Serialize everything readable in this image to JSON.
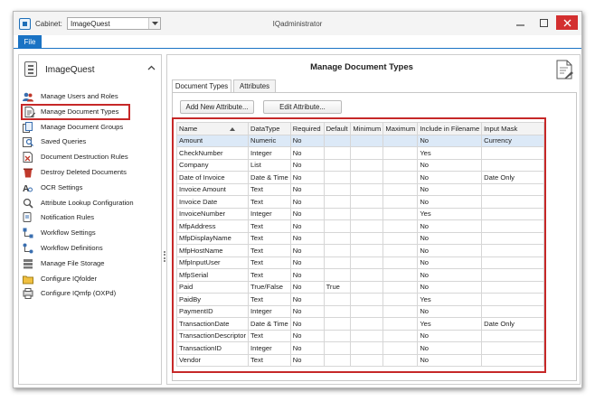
{
  "window": {
    "title": "IQadministrator",
    "cabinet_label": "Cabinet:",
    "cabinet_value": "ImageQuest"
  },
  "ribbon": {
    "file_tab": "File"
  },
  "sidebar": {
    "header": "ImageQuest",
    "items": [
      {
        "label": "Manage Users and Roles",
        "icon": "users-icon"
      },
      {
        "label": "Manage Document Types",
        "icon": "document-types-icon"
      },
      {
        "label": "Manage Document Groups",
        "icon": "document-groups-icon"
      },
      {
        "label": "Saved Queries",
        "icon": "saved-queries-icon"
      },
      {
        "label": "Document Destruction Rules",
        "icon": "destruction-rules-icon"
      },
      {
        "label": "Destroy Deleted Documents",
        "icon": "destroy-icon"
      },
      {
        "label": "OCR Settings",
        "icon": "ocr-icon"
      },
      {
        "label": "Attribute Lookup Configuration",
        "icon": "lookup-icon"
      },
      {
        "label": "Notification Rules",
        "icon": "notification-icon"
      },
      {
        "label": "Workflow Settings",
        "icon": "workflow-settings-icon"
      },
      {
        "label": "Workflow Definitions",
        "icon": "workflow-definitions-icon"
      },
      {
        "label": "Manage File Storage",
        "icon": "file-storage-icon"
      },
      {
        "label": "Configure IQfolder",
        "icon": "iqfolder-icon"
      },
      {
        "label": "Configure IQmfp (OXPd)",
        "icon": "iqmfp-icon"
      }
    ]
  },
  "main": {
    "title": "Manage Document Types",
    "tabs": [
      {
        "label": "Document Types"
      },
      {
        "label": "Attributes"
      }
    ],
    "buttons": {
      "add": "Add New Attribute...",
      "edit": "Edit Attribute..."
    },
    "columns": [
      "Name",
      "DataType",
      "Required",
      "Default",
      "Minimum",
      "Maximum",
      "Include in Filename",
      "Input Mask"
    ],
    "rows": [
      [
        "Amount",
        "Numeric",
        "No",
        "",
        "",
        "",
        "No",
        "Currency"
      ],
      [
        "CheckNumber",
        "Integer",
        "No",
        "",
        "",
        "",
        "Yes",
        ""
      ],
      [
        "Company",
        "List",
        "No",
        "",
        "",
        "",
        "No",
        ""
      ],
      [
        "Date of Invoice",
        "Date & Time",
        "No",
        "",
        "",
        "",
        "No",
        "Date Only"
      ],
      [
        "Invoice Amount",
        "Text",
        "No",
        "",
        "",
        "",
        "No",
        ""
      ],
      [
        "Invoice Date",
        "Text",
        "No",
        "",
        "",
        "",
        "No",
        ""
      ],
      [
        "InvoiceNumber",
        "Integer",
        "No",
        "",
        "",
        "",
        "Yes",
        ""
      ],
      [
        "MfpAddress",
        "Text",
        "No",
        "",
        "",
        "",
        "No",
        ""
      ],
      [
        "MfpDisplayName",
        "Text",
        "No",
        "",
        "",
        "",
        "No",
        ""
      ],
      [
        "MfpHostName",
        "Text",
        "No",
        "",
        "",
        "",
        "No",
        ""
      ],
      [
        "MfpInputUser",
        "Text",
        "No",
        "",
        "",
        "",
        "No",
        ""
      ],
      [
        "MfpSerial",
        "Text",
        "No",
        "",
        "",
        "",
        "No",
        ""
      ],
      [
        "Paid",
        "True/False",
        "No",
        "True",
        "",
        "",
        "No",
        ""
      ],
      [
        "PaidBy",
        "Text",
        "No",
        "",
        "",
        "",
        "Yes",
        ""
      ],
      [
        "PaymentID",
        "Integer",
        "No",
        "",
        "",
        "",
        "No",
        ""
      ],
      [
        "TransactionDate",
        "Date & Time",
        "No",
        "",
        "",
        "",
        "Yes",
        "Date Only"
      ],
      [
        "TransactionDescriptor",
        "Text",
        "No",
        "",
        "",
        "",
        "No",
        ""
      ],
      [
        "TransactionID",
        "Integer",
        "No",
        "",
        "",
        "",
        "No",
        ""
      ],
      [
        "Vendor",
        "Text",
        "No",
        "",
        "",
        "",
        "No",
        ""
      ]
    ]
  },
  "colors": {
    "accent": "#1a73c4",
    "highlight": "#c62828",
    "selected_row": "#dce9f7"
  }
}
